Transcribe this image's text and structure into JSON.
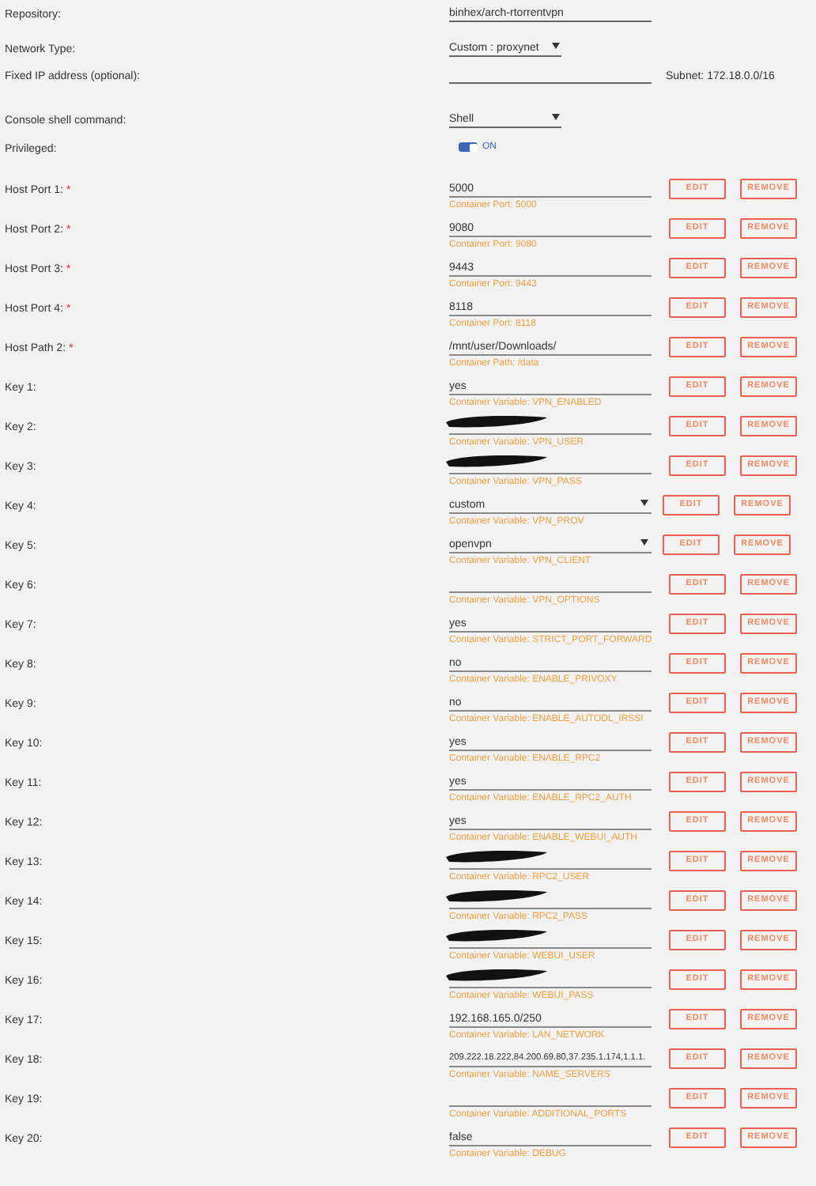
{
  "repository": {
    "label": "Repository:",
    "value": "binhex/arch-rtorrentvpn"
  },
  "network_type": {
    "label": "Network Type:",
    "value": "Custom : proxynet"
  },
  "fixed_ip": {
    "label": "Fixed IP address (optional):",
    "subnet": "Subnet: 172.18.0.0/16"
  },
  "console": {
    "label": "Console shell command:",
    "value": "Shell"
  },
  "privileged": {
    "label": "Privileged:",
    "on": true,
    "state_text": "ON"
  },
  "entries": [
    {
      "label": "Host Port 1:",
      "required_mark": "*",
      "kind": "text",
      "value": "5000",
      "caption": "Container Port: 5000",
      "buttons": [
        "EDIT",
        "REMOVE"
      ]
    },
    {
      "label": "Host Port 2:",
      "required_mark": "*",
      "kind": "text",
      "value": "9080",
      "caption": "Container Port: 9080",
      "buttons": [
        "EDIT",
        "REMOVE"
      ]
    },
    {
      "label": "Host Port 3:",
      "required_mark": "*",
      "kind": "text",
      "value": "9443",
      "caption": "Container Port: 9443",
      "buttons": [
        "EDIT",
        "REMOVE"
      ]
    },
    {
      "label": "Host Port 4:",
      "required_mark": "*",
      "kind": "text",
      "value": "8118",
      "caption": "Container Port: 8118",
      "buttons": [
        "EDIT",
        "REMOVE"
      ]
    },
    {
      "label": "Host Path 2:",
      "required_mark": "*",
      "kind": "text",
      "value": "/mnt/user/Downloads/",
      "caption": "Container Path: /data",
      "buttons": [
        "EDIT",
        "REMOVE"
      ]
    },
    {
      "label": "Key 1:",
      "kind": "text",
      "value": "yes",
      "caption": "Container Variable: VPN_ENABLED",
      "buttons": [
        "EDIT",
        "REMOVE"
      ]
    },
    {
      "label": "Key 2:",
      "kind": "redacted",
      "caption": "Container Variable: VPN_USER",
      "buttons": [
        "EDIT",
        "REMOVE"
      ]
    },
    {
      "label": "Key 3:",
      "kind": "redacted",
      "caption": "Container Variable: VPN_PASS",
      "buttons": [
        "EDIT",
        "REMOVE"
      ]
    },
    {
      "label": "Key 4:",
      "kind": "select",
      "value": "custom",
      "caption": "Container Variable: VPN_PROV",
      "buttons": [
        "EDIT",
        "REMOVE"
      ]
    },
    {
      "label": "Key 5:",
      "kind": "select",
      "value": "openvpn",
      "caption": "Container Variable: VPN_CLIENT",
      "buttons": [
        "EDIT",
        "REMOVE"
      ]
    },
    {
      "label": "Key 6:",
      "kind": "text",
      "caption": "Container Variable: VPN_OPTIONS",
      "buttons": [
        "EDIT",
        "REMOVE"
      ]
    },
    {
      "label": "Key 7:",
      "kind": "text",
      "value": "yes",
      "caption": "Container Variable: STRICT_PORT_FORWARD",
      "buttons": [
        "EDIT",
        "REMOVE"
      ]
    },
    {
      "label": "Key 8:",
      "kind": "text",
      "value": "no",
      "caption": "Container Variable: ENABLE_PRIVOXY",
      "buttons": [
        "EDIT",
        "REMOVE"
      ]
    },
    {
      "label": "Key 9:",
      "kind": "text",
      "value": "no",
      "caption": "Container Variable: ENABLE_AUTODL_IRSSI",
      "buttons": [
        "EDIT",
        "REMOVE"
      ]
    },
    {
      "label": "Key 10:",
      "kind": "text",
      "value": "yes",
      "caption": "Container Variable: ENABLE_RPC2",
      "buttons": [
        "EDIT",
        "REMOVE"
      ]
    },
    {
      "label": "Key 11:",
      "kind": "text",
      "value": "yes",
      "caption": "Container Variable: ENABLE_RPC2_AUTH",
      "buttons": [
        "EDIT",
        "REMOVE"
      ]
    },
    {
      "label": "Key 12:",
      "kind": "text",
      "value": "yes",
      "caption": "Container Variable: ENABLE_WEBUI_AUTH",
      "buttons": [
        "EDIT",
        "REMOVE"
      ]
    },
    {
      "label": "Key 13:",
      "kind": "redacted",
      "caption": "Container Variable: RPC2_USER",
      "buttons": [
        "EDIT",
        "REMOVE"
      ]
    },
    {
      "label": "Key 14:",
      "kind": "redacted",
      "caption": "Container Variable: RPC2_PASS",
      "buttons": [
        "EDIT",
        "REMOVE"
      ]
    },
    {
      "label": "Key 15:",
      "kind": "redacted",
      "caption": "Container Variable: WEBUI_USER",
      "buttons": [
        "EDIT",
        "REMOVE"
      ]
    },
    {
      "label": "Key 16:",
      "kind": "redacted",
      "caption": "Container Variable: WEBUI_PASS",
      "buttons": [
        "EDIT",
        "REMOVE"
      ]
    },
    {
      "label": "Key 17:",
      "kind": "text",
      "value": "192.168.165.0/250",
      "caption": "Container Variable: LAN_NETWORK",
      "buttons": [
        "EDIT",
        "REMOVE"
      ]
    },
    {
      "label": "Key 18:",
      "kind": "text",
      "value": "209.222.18.222,84.200.69.80,37.235.1.174,1.1.1.",
      "caption": "Container Variable: NAME_SERVERS",
      "buttons": [
        "EDIT",
        "REMOVE"
      ]
    },
    {
      "label": "Key 19:",
      "kind": "text",
      "caption": "Container Variable: ADDITIONAL_PORTS",
      "buttons": [
        "EDIT",
        "REMOVE"
      ]
    },
    {
      "label": "Key 20:",
      "kind": "text",
      "value": "false",
      "caption": "Container Variable: DEBUG",
      "buttons": [
        "EDIT",
        "REMOVE"
      ]
    }
  ]
}
